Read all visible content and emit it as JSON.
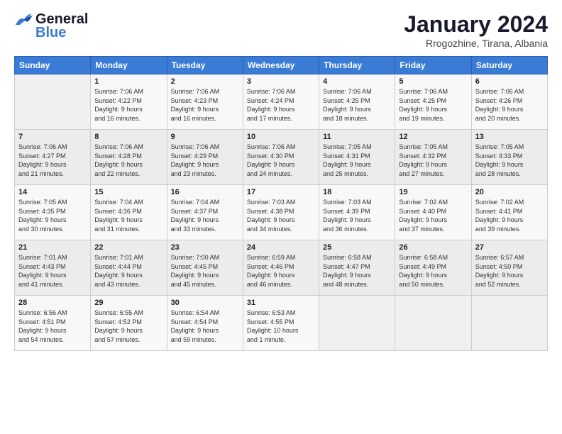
{
  "header": {
    "logo_general": "General",
    "logo_blue": "Blue",
    "month": "January 2024",
    "location": "Rrogozhine, Tirana, Albania"
  },
  "days_of_week": [
    "Sunday",
    "Monday",
    "Tuesday",
    "Wednesday",
    "Thursday",
    "Friday",
    "Saturday"
  ],
  "weeks": [
    [
      {
        "day": "",
        "content": ""
      },
      {
        "day": "1",
        "content": "Sunrise: 7:06 AM\nSunset: 4:22 PM\nDaylight: 9 hours\nand 16 minutes."
      },
      {
        "day": "2",
        "content": "Sunrise: 7:06 AM\nSunset: 4:23 PM\nDaylight: 9 hours\nand 16 minutes."
      },
      {
        "day": "3",
        "content": "Sunrise: 7:06 AM\nSunset: 4:24 PM\nDaylight: 9 hours\nand 17 minutes."
      },
      {
        "day": "4",
        "content": "Sunrise: 7:06 AM\nSunset: 4:25 PM\nDaylight: 9 hours\nand 18 minutes."
      },
      {
        "day": "5",
        "content": "Sunrise: 7:06 AM\nSunset: 4:25 PM\nDaylight: 9 hours\nand 19 minutes."
      },
      {
        "day": "6",
        "content": "Sunrise: 7:06 AM\nSunset: 4:26 PM\nDaylight: 9 hours\nand 20 minutes."
      }
    ],
    [
      {
        "day": "7",
        "content": ""
      },
      {
        "day": "8",
        "content": "Sunrise: 7:06 AM\nSunset: 4:28 PM\nDaylight: 9 hours\nand 22 minutes."
      },
      {
        "day": "9",
        "content": "Sunrise: 7:06 AM\nSunset: 4:29 PM\nDaylight: 9 hours\nand 23 minutes."
      },
      {
        "day": "10",
        "content": "Sunrise: 7:06 AM\nSunset: 4:30 PM\nDaylight: 9 hours\nand 24 minutes."
      },
      {
        "day": "11",
        "content": "Sunrise: 7:05 AM\nSunset: 4:31 PM\nDaylight: 9 hours\nand 25 minutes."
      },
      {
        "day": "12",
        "content": "Sunrise: 7:05 AM\nSunset: 4:32 PM\nDaylight: 9 hours\nand 27 minutes."
      },
      {
        "day": "13",
        "content": "Sunrise: 7:05 AM\nSunset: 4:33 PM\nDaylight: 9 hours\nand 28 minutes."
      }
    ],
    [
      {
        "day": "14",
        "content": ""
      },
      {
        "day": "15",
        "content": "Sunrise: 7:04 AM\nSunset: 4:36 PM\nDaylight: 9 hours\nand 31 minutes."
      },
      {
        "day": "16",
        "content": "Sunrise: 7:04 AM\nSunset: 4:37 PM\nDaylight: 9 hours\nand 33 minutes."
      },
      {
        "day": "17",
        "content": "Sunrise: 7:03 AM\nSunset: 4:38 PM\nDaylight: 9 hours\nand 34 minutes."
      },
      {
        "day": "18",
        "content": "Sunrise: 7:03 AM\nSunset: 4:39 PM\nDaylight: 9 hours\nand 36 minutes."
      },
      {
        "day": "19",
        "content": "Sunrise: 7:02 AM\nSunset: 4:40 PM\nDaylight: 9 hours\nand 37 minutes."
      },
      {
        "day": "20",
        "content": "Sunrise: 7:02 AM\nSunset: 4:41 PM\nDaylight: 9 hours\nand 39 minutes."
      }
    ],
    [
      {
        "day": "21",
        "content": "Sunrise: 7:01 AM\nSunset: 4:43 PM\nDaylight: 9 hours\nand 41 minutes."
      },
      {
        "day": "22",
        "content": "Sunrise: 7:01 AM\nSunset: 4:44 PM\nDaylight: 9 hours\nand 43 minutes."
      },
      {
        "day": "23",
        "content": "Sunrise: 7:00 AM\nSunset: 4:45 PM\nDaylight: 9 hours\nand 45 minutes."
      },
      {
        "day": "24",
        "content": "Sunrise: 6:59 AM\nSunset: 4:46 PM\nDaylight: 9 hours\nand 46 minutes."
      },
      {
        "day": "25",
        "content": "Sunrise: 6:58 AM\nSunset: 4:47 PM\nDaylight: 9 hours\nand 48 minutes."
      },
      {
        "day": "26",
        "content": "Sunrise: 6:58 AM\nSunset: 4:49 PM\nDaylight: 9 hours\nand 50 minutes."
      },
      {
        "day": "27",
        "content": "Sunrise: 6:57 AM\nSunset: 4:50 PM\nDaylight: 9 hours\nand 52 minutes."
      }
    ],
    [
      {
        "day": "28",
        "content": "Sunrise: 6:56 AM\nSunset: 4:51 PM\nDaylight: 9 hours\nand 54 minutes."
      },
      {
        "day": "29",
        "content": "Sunrise: 6:55 AM\nSunset: 4:52 PM\nDaylight: 9 hours\nand 57 minutes."
      },
      {
        "day": "30",
        "content": "Sunrise: 6:54 AM\nSunset: 4:54 PM\nDaylight: 9 hours\nand 59 minutes."
      },
      {
        "day": "31",
        "content": "Sunrise: 6:53 AM\nSunset: 4:55 PM\nDaylight: 10 hours\nand 1 minute."
      },
      {
        "day": "",
        "content": ""
      },
      {
        "day": "",
        "content": ""
      },
      {
        "day": "",
        "content": ""
      }
    ]
  ],
  "week2_sun": {
    "day": "7",
    "content": "Sunrise: 7:06 AM\nSunset: 4:27 PM\nDaylight: 9 hours\nand 21 minutes."
  },
  "week3_sun": {
    "day": "14",
    "content": "Sunrise: 7:05 AM\nSunset: 4:35 PM\nDaylight: 9 hours\nand 30 minutes."
  }
}
